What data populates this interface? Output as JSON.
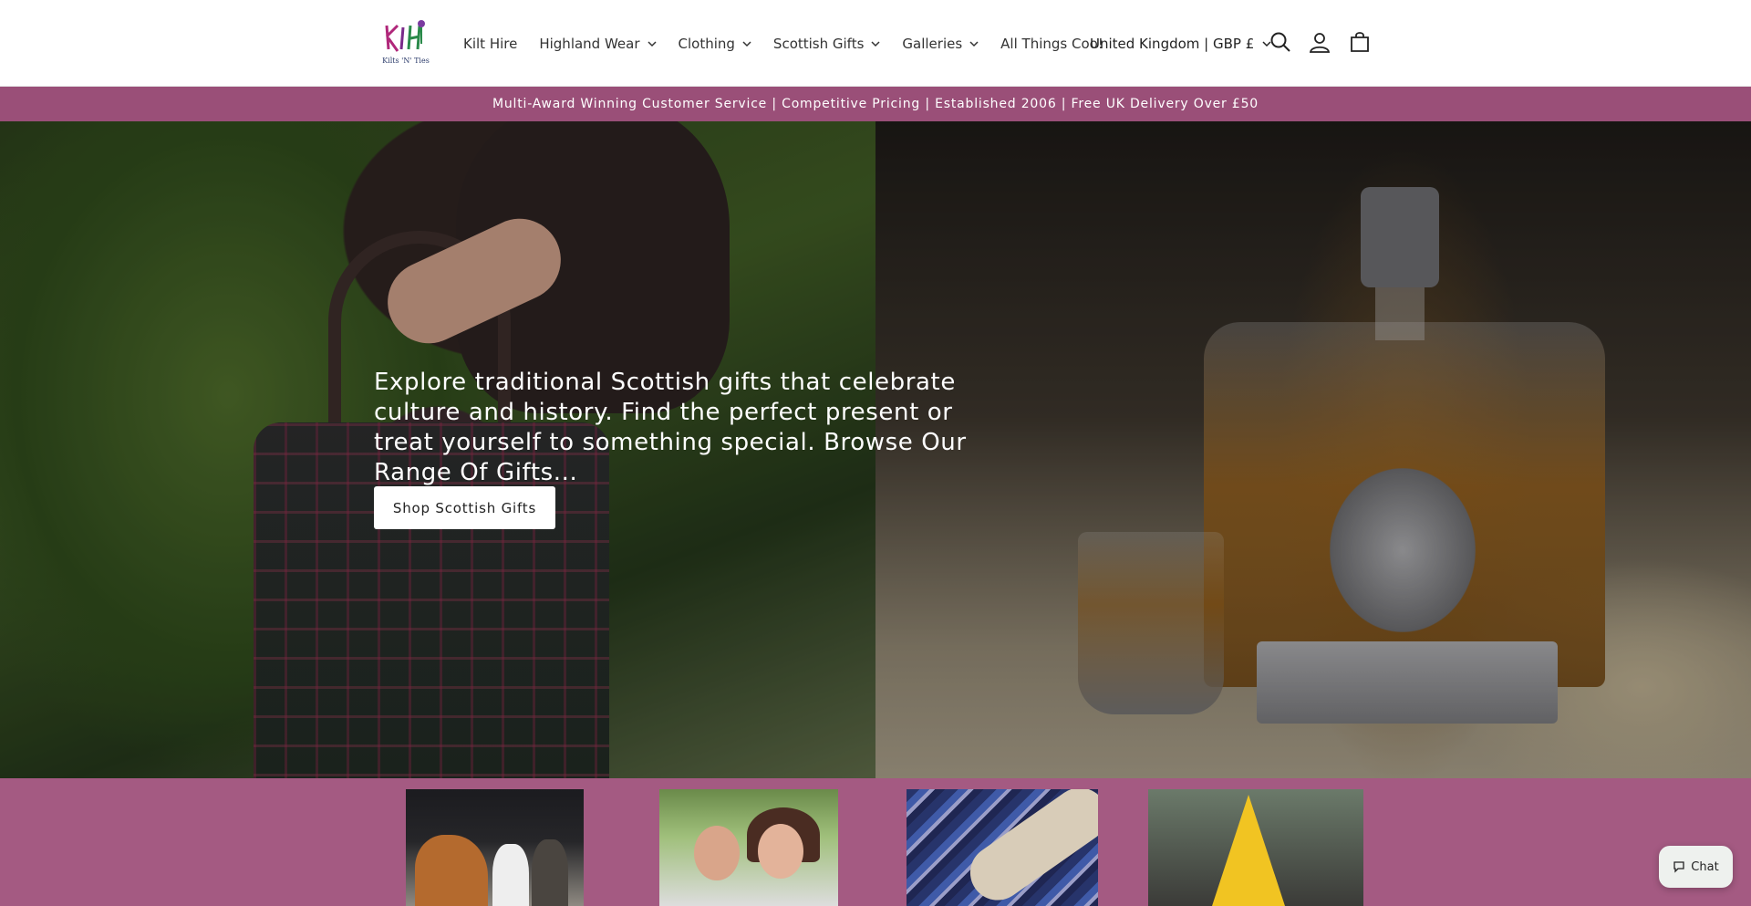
{
  "header": {
    "logo_text": "Kilts 'N' Ties",
    "nav": [
      {
        "label": "Kilt Hire",
        "has_dropdown": false
      },
      {
        "label": "Highland Wear",
        "has_dropdown": true
      },
      {
        "label": "Clothing",
        "has_dropdown": true
      },
      {
        "label": "Scottish Gifts",
        "has_dropdown": true
      },
      {
        "label": "Galleries",
        "has_dropdown": true
      },
      {
        "label": "All Things Coo!",
        "has_dropdown": false
      }
    ],
    "country_selector": "United Kingdom | GBP £",
    "icons": [
      "search-icon",
      "account-icon",
      "cart-icon"
    ]
  },
  "announcement": "Multi-Award Winning Customer Service | Competitive Pricing | Established 2006 | Free UK Delivery Over £50",
  "hero": {
    "heading": "Explore traditional Scottish gifts that celebrate culture and history. Find the perfect present or treat yourself to something special. Browse Our Range Of Gifts...",
    "button_label": "Shop Scottish Gifts"
  },
  "chat": {
    "label": "Chat"
  },
  "colors": {
    "accent": "#9a4f78",
    "strip": "#a45a82"
  }
}
